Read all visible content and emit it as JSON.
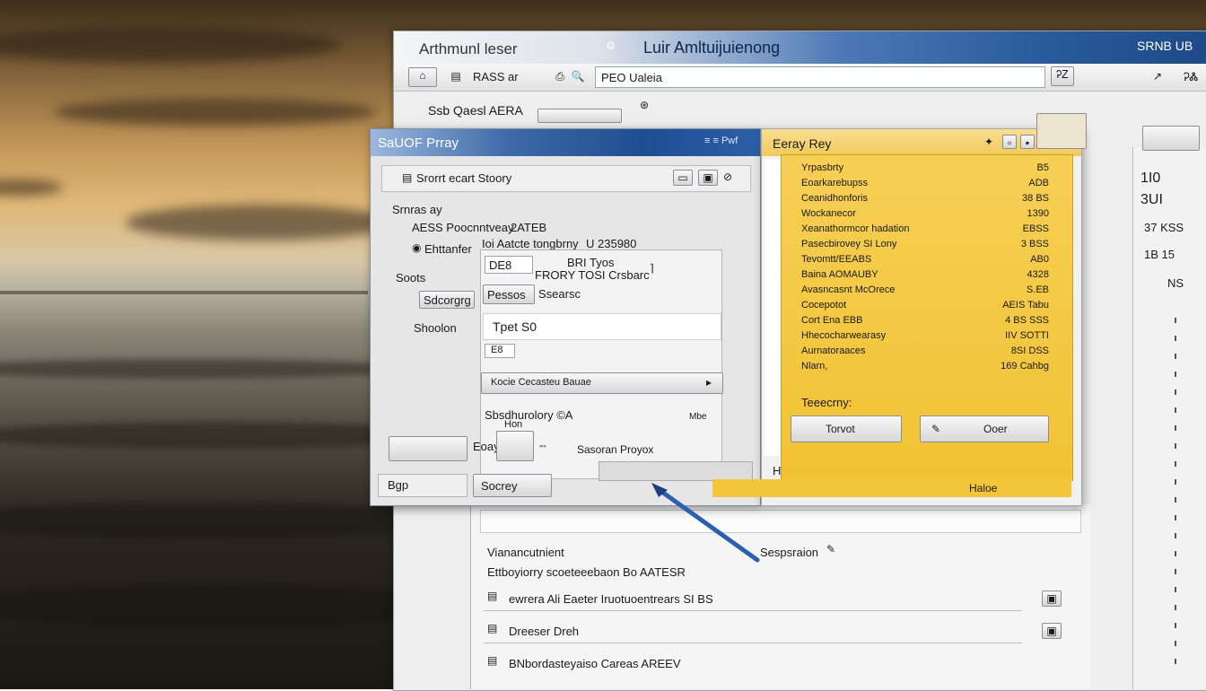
{
  "back_window": {
    "title_left": "Arthmunl leser",
    "title_center": "Luir Amltuijuienong",
    "title_right": "SRNB UB",
    "toolbar_left": "RASS ar",
    "address_value": "PEO Ualeia",
    "address_right": "ᎮᏃ",
    "top_right_icon": "↗",
    "sub_label": "Ssb Qaesl AERA",
    "top_right_number": "ᎮᏜ"
  },
  "dialog": {
    "title": "SaUOF Prray",
    "title_right": "≡ ≡ Pwf",
    "section_label": "Srorrt ecart Stoory",
    "heading_1": "Srnras ay",
    "row_1_label": "AESS Poocnntveay",
    "row_1_value": "2ATEB",
    "row_2_label": "Ehttanfer",
    "row_2_value": "Ioi Aatcte tongbrny",
    "row_2_tail": "U 235980",
    "heading_2": "Soots",
    "combo_a_text": "DE8",
    "combo_a_mid": "BRI Tyos",
    "combo_b_text": "FRORY TOSI Crsbarc",
    "label_scorgrg": "Sdcorgrg",
    "button_pessos": "Pessos",
    "button_pessos_right": "Ssearsc",
    "label_shoolon": "Shoolon",
    "input_value": "Tpet S0",
    "small_box": "E8",
    "dropdown_text": "Kocie Cecasteu Bauae",
    "bottom_label": "Sbsdhurolory ©A",
    "bottom_label_2": "Hon",
    "bottom_right_small": "Mbe",
    "footer_label": "Eoay",
    "footer_right": "Sasoran Proyox",
    "footer_icons": "Bgp",
    "footer_button": "Socrey"
  },
  "yellow_panel": {
    "title": "Eeray Rey",
    "rows": [
      {
        "label": "Yrpasbrty",
        "value": "B5"
      },
      {
        "label": "Eoarkarebupss",
        "value": "ADB"
      },
      {
        "label": "Ceanidhonforis",
        "value": "38 BS"
      },
      {
        "label": "Wockanecor",
        "value": "1390"
      },
      {
        "label": "Xeanathormcor hadation",
        "value": "EBSS"
      },
      {
        "label": "Pasecbirovey SI Lony",
        "value": "3 BSS"
      },
      {
        "label": "Tevomtt/EEABS",
        "value": "AB0"
      },
      {
        "label": "Baina AOMAUBY",
        "value": "4328"
      },
      {
        "label": "Avasncasnt McOrece",
        "value": "S.EB"
      },
      {
        "label": "Cocepotot",
        "value": "AEIS Tabu"
      },
      {
        "label": "Cort Ena EBB",
        "value": "4 BS SSS"
      },
      {
        "label": "Hhecocharwearasy",
        "value": "IIV SOTTI"
      },
      {
        "label": "Aurnatoraaces",
        "value": "8SI DSS"
      },
      {
        "label": "Nlarn,",
        "value": "169 Cahbg"
      }
    ],
    "section_label": "Teeecrny:",
    "button_1": "Torvot",
    "button_2": "Ooer",
    "bottom_letter": "H",
    "footer_text": "Haloe"
  },
  "lower_pane": {
    "heading": "Vianancutnient",
    "heading_right": "Sespsraion",
    "subline": "Ettboyiorry scoeteeebaon Bo AATESR",
    "rows": [
      {
        "text": "ewrera Ali Eaeter Iruotuoentrears SI BS"
      },
      {
        "text": "Dreeser Dreh"
      },
      {
        "text": "BNbordasteyaiso Careas AREEV"
      }
    ]
  },
  "right_column": {
    "lines": [
      "1I0",
      "3UI",
      "37 KSS",
      "1B 15",
      "NS"
    ]
  },
  "colors": {
    "accent_blue": "#2a5a9c",
    "panel_yellow": "#f1c233"
  }
}
